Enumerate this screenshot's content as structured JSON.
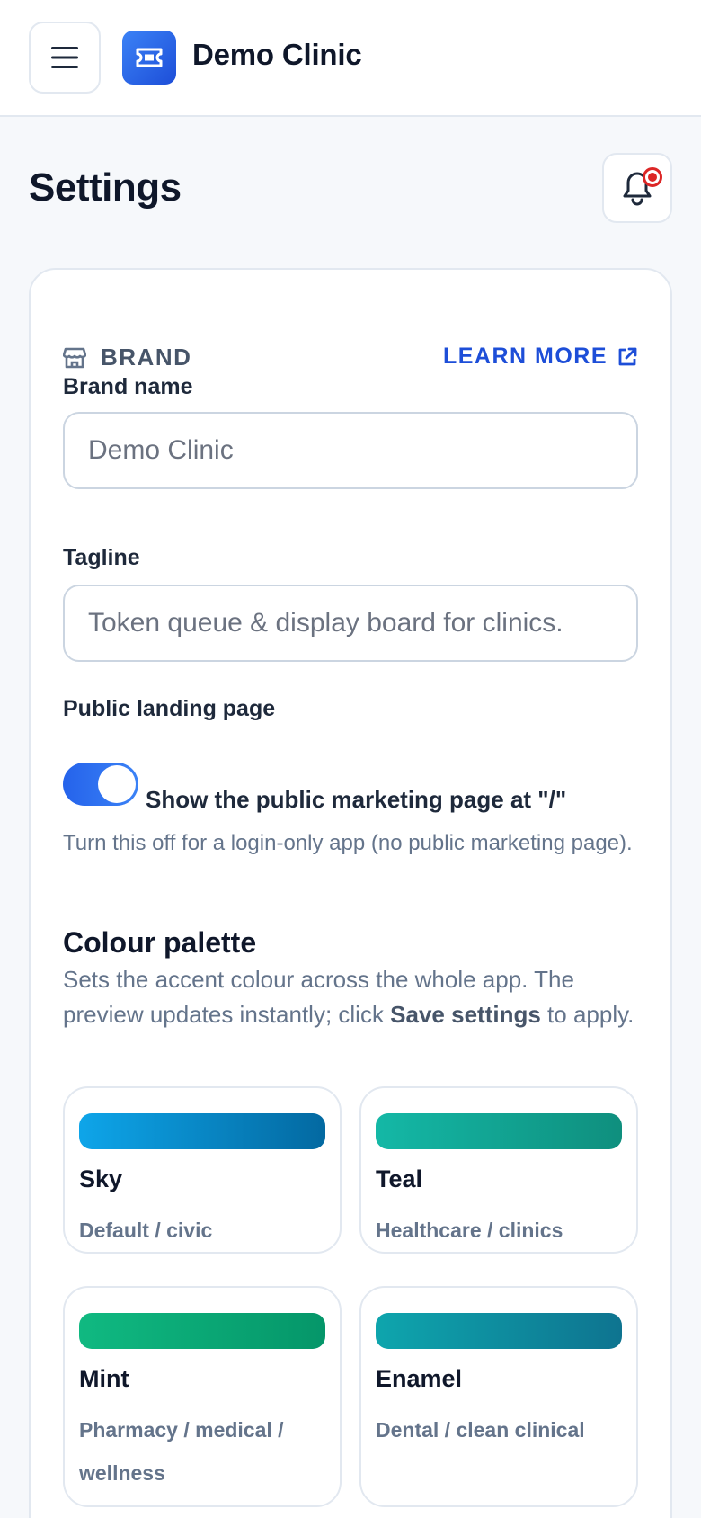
{
  "header": {
    "app_title": "Demo Clinic",
    "menu_icon": "hamburger-menu-icon",
    "logo_icon": "ticket-icon"
  },
  "page": {
    "title": "Settings",
    "notification_icon": "bell-icon",
    "notification_badge_color": "#dc2626"
  },
  "brand_section": {
    "label": "BRAND",
    "icon": "storefront-icon",
    "learn_more": "LEARN MORE",
    "learn_more_icon": "external-link-icon",
    "brand_name_label": "Brand name",
    "brand_name_placeholder": "Demo Clinic",
    "tagline_label": "Tagline",
    "tagline_placeholder": "Token queue & display board for clinics.",
    "landing_label": "Public landing page",
    "landing_toggle_on": true,
    "landing_toggle_text": "Show the public marketing page at \"/\"",
    "landing_hint": "Turn this off for a login-only app (no public marketing page)."
  },
  "palette": {
    "title": "Colour palette",
    "desc_before": "Sets the accent colour across the whole app. The preview updates instantly; click ",
    "desc_bold": "Save settings",
    "desc_after": " to apply.",
    "options": [
      {
        "name": "Sky",
        "desc": "Default / civic",
        "color_from": "#0ea5e9",
        "color_to": "#0369a1"
      },
      {
        "name": "Teal",
        "desc": "Healthcare / clinics",
        "color_from": "#14b8a6",
        "color_to": "#0f8f7e"
      },
      {
        "name": "Mint",
        "desc": "Pharmacy / medical / wellness",
        "color_from": "#10b981",
        "color_to": "#059669"
      },
      {
        "name": "Enamel",
        "desc": "Dental / clean clinical",
        "color_from": "#0ea5ad",
        "color_to": "#0e7490"
      }
    ]
  },
  "accent_color": "#1d4ed8"
}
